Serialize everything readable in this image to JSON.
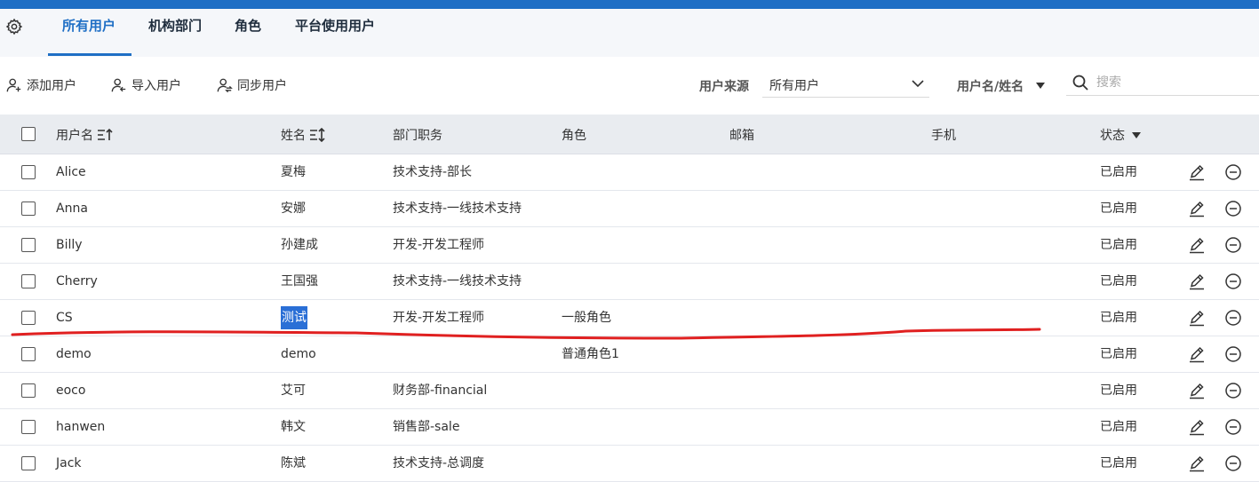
{
  "tabs": [
    {
      "label": "所有用户",
      "active": true
    },
    {
      "label": "机构部门",
      "active": false
    },
    {
      "label": "角色",
      "active": false
    },
    {
      "label": "平台使用用户",
      "active": false
    }
  ],
  "toolbar": {
    "add_user": "添加用户",
    "import_user": "导入用户",
    "sync_user": "同步用户"
  },
  "filter": {
    "source_label": "用户来源",
    "source_value": "所有用户",
    "search_mode": "用户名/姓名",
    "search_placeholder": "搜索"
  },
  "table": {
    "columns": {
      "username": "用户名",
      "name": "姓名",
      "dept": "部门职务",
      "role": "角色",
      "email": "邮箱",
      "phone": "手机",
      "status": "状态"
    },
    "rows": [
      {
        "username": "Alice",
        "name": "夏梅",
        "dept": "技术支持-部长",
        "role": "",
        "email": "",
        "phone": "",
        "status": "已启用"
      },
      {
        "username": "Anna",
        "name": "安娜",
        "dept": "技术支持-一线技术支持",
        "role": "",
        "email": "",
        "phone": "",
        "status": "已启用"
      },
      {
        "username": "Billy",
        "name": "孙建成",
        "dept": "开发-开发工程师",
        "role": "",
        "email": "",
        "phone": "",
        "status": "已启用"
      },
      {
        "username": "Cherry",
        "name": "王国强",
        "dept": "技术支持-一线技术支持",
        "role": "",
        "email": "",
        "phone": "",
        "status": "已启用"
      },
      {
        "username": "CS",
        "name": "测试",
        "dept": "开发-开发工程师",
        "role": "一般角色",
        "email": "",
        "phone": "",
        "status": "已启用",
        "name_selected": true
      },
      {
        "username": "demo",
        "name": "demo",
        "dept": "",
        "role": "普通角色1",
        "email": "",
        "phone": "",
        "status": "已启用"
      },
      {
        "username": "eoco",
        "name": "艾可",
        "dept": "财务部-financial",
        "role": "",
        "email": "",
        "phone": "",
        "status": "已启用"
      },
      {
        "username": "hanwen",
        "name": "韩文",
        "dept": "销售部-sale",
        "role": "",
        "email": "",
        "phone": "",
        "status": "已启用"
      },
      {
        "username": "Jack",
        "name": "陈斌",
        "dept": "技术支持-总调度",
        "role": "",
        "email": "",
        "phone": "",
        "status": "已启用"
      }
    ]
  },
  "icons": {
    "settings": "gear-icon",
    "add_user": "user-add-icon",
    "import_user": "user-import-icon",
    "sync_user": "user-sync-icon",
    "search": "search-icon",
    "sort": "sort-icon",
    "edit": "edit-icon",
    "disable": "minus-circle-icon"
  },
  "colors": {
    "accent": "#1f6fc5",
    "selection": "#2a6fd6",
    "annotation": "#e02020"
  }
}
